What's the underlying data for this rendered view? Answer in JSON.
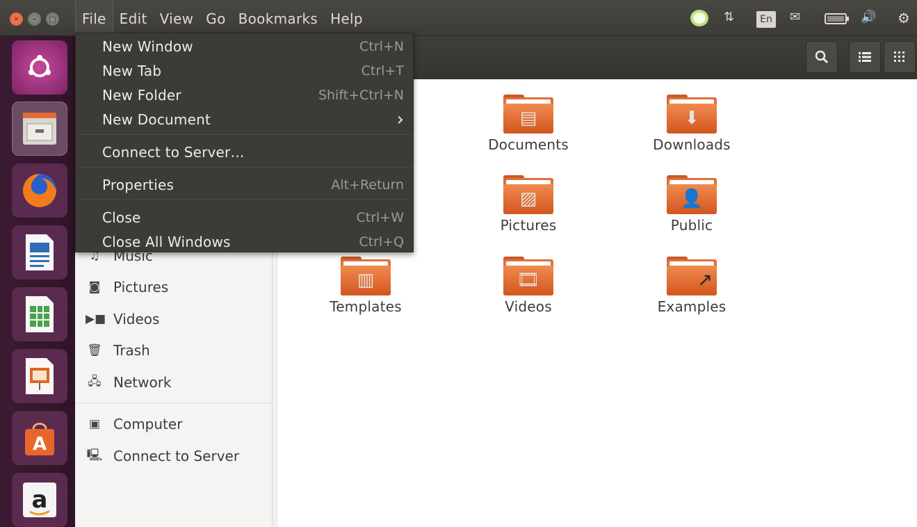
{
  "menubar": {
    "items": [
      "File",
      "Edit",
      "View",
      "Go",
      "Bookmarks",
      "Help"
    ],
    "active": "File"
  },
  "indicators": {
    "keyboard_layout": "En"
  },
  "file_menu": {
    "items": [
      {
        "label": "New Window",
        "shortcut": "Ctrl+N"
      },
      {
        "label": "New Tab",
        "shortcut": "Ctrl+T"
      },
      {
        "label": "New Folder",
        "shortcut": "Shift+Ctrl+N"
      },
      {
        "label": "New Document",
        "submenu_arrow": "›"
      },
      {
        "label": "Connect to Server…"
      },
      {
        "label": "Properties",
        "shortcut": "Alt+Return"
      },
      {
        "label": "Close",
        "shortcut": "Ctrl+W"
      },
      {
        "label": "Close All Windows",
        "shortcut": "Ctrl+Q"
      }
    ]
  },
  "sidebar": {
    "items": [
      {
        "label": "Music",
        "icon": "music-icon"
      },
      {
        "label": "Pictures",
        "icon": "camera-icon"
      },
      {
        "label": "Videos",
        "icon": "video-icon"
      },
      {
        "label": "Trash",
        "icon": "trash-icon"
      },
      {
        "label": "Network",
        "icon": "network-icon"
      },
      {
        "label": "Computer",
        "icon": "computer-icon"
      },
      {
        "label": "Connect to Server",
        "icon": "server-icon"
      }
    ]
  },
  "folders": [
    {
      "label": "Documents",
      "emblem": "document-emblem"
    },
    {
      "label": "Downloads",
      "emblem": "download-emblem"
    },
    {
      "label": "Pictures",
      "emblem": "pictures-emblem"
    },
    {
      "label": "Public",
      "emblem": "person-emblem"
    },
    {
      "label": "Templates",
      "emblem": "template-emblem"
    },
    {
      "label": "Videos",
      "emblem": "film-emblem"
    },
    {
      "label": "Examples",
      "emblem": "link-emblem"
    }
  ],
  "colors": {
    "panel": "#3c3b37",
    "launcher": "#2f1428",
    "folder_orange": "#e0703a",
    "close_button": "#e0572c"
  }
}
